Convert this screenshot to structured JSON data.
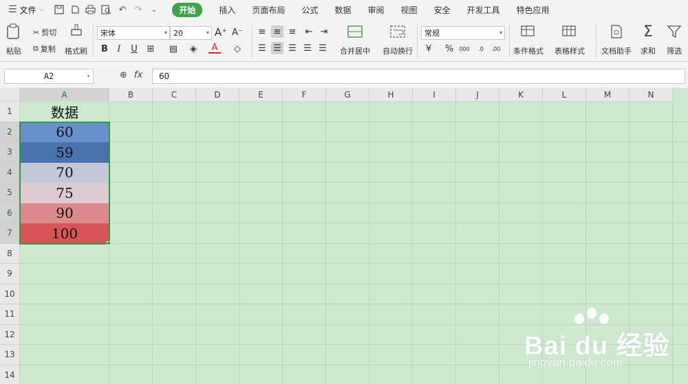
{
  "menubar": {
    "file_label": "文件",
    "tabs": [
      {
        "label": "开始",
        "active": true
      },
      {
        "label": "插入"
      },
      {
        "label": "页面布局"
      },
      {
        "label": "公式"
      },
      {
        "label": "数据"
      },
      {
        "label": "审阅"
      },
      {
        "label": "视图"
      },
      {
        "label": "安全"
      },
      {
        "label": "开发工具"
      },
      {
        "label": "特色应用"
      }
    ]
  },
  "ribbon": {
    "paste": "粘贴",
    "cut": "剪切",
    "copy": "复制",
    "format_painter": "格式刷",
    "font_name": "宋体",
    "font_size": "20",
    "merge_center": "合并居中",
    "wrap_text": "自动换行",
    "number_format": "常规",
    "conditional_format": "条件格式",
    "table_style": "表格样式",
    "doc_assistant": "文档助手",
    "sum": "求和",
    "filter": "筛选",
    "bold": "B",
    "italic": "I",
    "underline": "U",
    "font_color_letter": "A",
    "percent": "%",
    "thousands": "000",
    "dec_inc": ".0",
    "dec_dec": ".00"
  },
  "formula_bar": {
    "name_box": "A2",
    "fx": "fx",
    "value": "60"
  },
  "sheet": {
    "columns": [
      "A",
      "B",
      "C",
      "D",
      "E",
      "F",
      "G",
      "H",
      "I",
      "J",
      "K",
      "L",
      "M",
      "N"
    ],
    "rows": [
      "1",
      "2",
      "3",
      "4",
      "5",
      "6",
      "7",
      "8",
      "9",
      "10",
      "11",
      "12",
      "13",
      "14"
    ],
    "header_cell": "数据",
    "values": [
      "60",
      "59",
      "70",
      "75",
      "90",
      "100"
    ],
    "value_colors": [
      "#6790cc",
      "#4a72ad",
      "#c2c8d8",
      "#dcccd0",
      "#dd8a8e",
      "#d95458"
    ],
    "grid_bg": "#cce8cf",
    "selection_color": "#2f9a3e"
  },
  "watermark": {
    "brand": "Bai du 经验",
    "site": "jingyan.baidu.com"
  }
}
